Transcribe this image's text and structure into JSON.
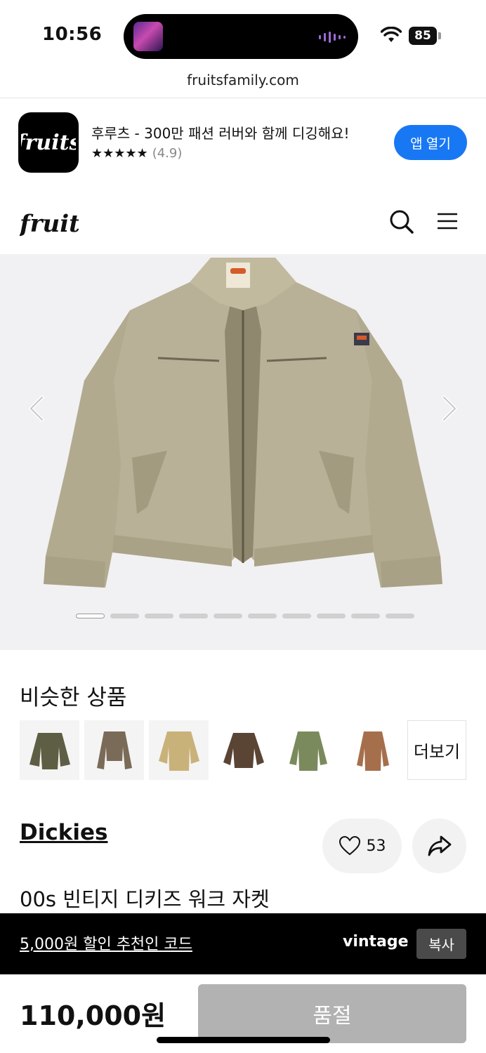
{
  "status_bar": {
    "time": "10:56",
    "battery": "85"
  },
  "browser": {
    "url": "fruitsfamily.com"
  },
  "app_banner": {
    "title": "후루츠 - 300만 패션 러버와 함께 디깅해요!",
    "stars": "★★★★★",
    "rating": "(4.9)",
    "open_button": "앱 열기"
  },
  "header": {
    "logo": "fruits"
  },
  "gallery": {
    "image_count": 10,
    "active_index": 0
  },
  "similar": {
    "title": "비슷한 상품",
    "more_label": "더보기"
  },
  "product": {
    "brand": "Dickies",
    "likes": "53",
    "name": "00s 빈티지 디키즈 워크 자켓"
  },
  "promo": {
    "text": "5,000원 할인 추천인 코드",
    "code": "vintage",
    "copy_label": "복사"
  },
  "purchase": {
    "price": "110,000원",
    "sold_out_label": "품절"
  },
  "colors": {
    "accent": "#1878f3",
    "sold_out": "#b2b2b2",
    "jacket": "#b5ad93"
  }
}
